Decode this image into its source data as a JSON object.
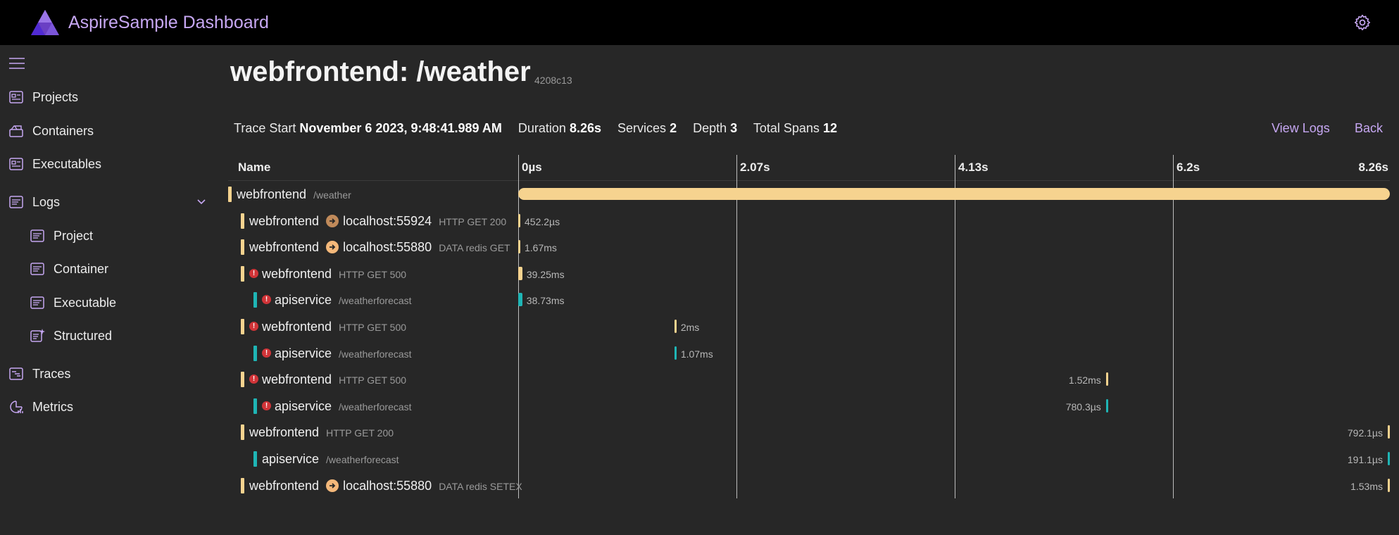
{
  "app": {
    "title": "AspireSample Dashboard"
  },
  "sidebar": {
    "items": [
      {
        "label": "Projects",
        "icon": "projects-icon"
      },
      {
        "label": "Containers",
        "icon": "containers-icon"
      },
      {
        "label": "Executables",
        "icon": "executables-icon"
      },
      {
        "label": "Logs",
        "icon": "logs-icon",
        "expanded": true
      },
      {
        "label": "Project",
        "icon": "log-file-icon"
      },
      {
        "label": "Container",
        "icon": "log-file-icon"
      },
      {
        "label": "Executable",
        "icon": "log-file-icon"
      },
      {
        "label": "Structured",
        "icon": "structured-log-icon"
      },
      {
        "label": "Traces",
        "icon": "traces-icon"
      },
      {
        "label": "Metrics",
        "icon": "metrics-icon"
      }
    ]
  },
  "trace": {
    "title": "webfrontend: /weather",
    "id": "4208c13",
    "start_label": "Trace Start",
    "start_value": "November 6 2023, 9:48:41.989 AM",
    "duration_label": "Duration",
    "duration_value": "8.26s",
    "services_label": "Services",
    "services_value": "2",
    "depth_label": "Depth",
    "depth_value": "3",
    "spans_label": "Total Spans",
    "spans_value": "12",
    "view_logs": "View Logs",
    "back": "Back"
  },
  "table": {
    "name_header": "Name",
    "ticks": [
      "0µs",
      "2.07s",
      "4.13s",
      "6.2s",
      "8.26s"
    ],
    "total_seconds": 8.26,
    "rows": [
      {
        "service": "webfrontend",
        "sub": "/weather",
        "peer": "",
        "color": "#f6d38f",
        "depth": 0,
        "error": false,
        "start": 0,
        "duration": 8.26,
        "dur_label": ""
      },
      {
        "service": "webfrontend",
        "sub": "HTTP GET 200",
        "peer": "localhost:55924",
        "peer_color": "#c08a5a",
        "color": "#f6d38f",
        "depth": 1,
        "error": false,
        "start": 0.0,
        "duration": 0.0004522,
        "dur_label": "452.2µs"
      },
      {
        "service": "webfrontend",
        "sub": "DATA redis GET",
        "peer": "localhost:55880",
        "peer_color": "#f4b87a",
        "color": "#f6d38f",
        "depth": 1,
        "error": false,
        "start": 0.0,
        "duration": 0.00167,
        "dur_label": "1.67ms"
      },
      {
        "service": "webfrontend",
        "sub": "HTTP GET 500",
        "peer": "",
        "color": "#f6d38f",
        "depth": 1,
        "error": true,
        "start": 0.0,
        "duration": 0.03925,
        "dur_label": "39.25ms"
      },
      {
        "service": "apiservice",
        "sub": "/weatherforecast",
        "peer": "",
        "color": "#1fb5b5",
        "depth": 2,
        "error": true,
        "start": 0.0,
        "duration": 0.03873,
        "dur_label": "38.73ms"
      },
      {
        "service": "webfrontend",
        "sub": "HTTP GET 500",
        "peer": "",
        "color": "#f6d38f",
        "depth": 1,
        "error": true,
        "start": 1.48,
        "duration": 0.002,
        "dur_label": "2ms"
      },
      {
        "service": "apiservice",
        "sub": "/weatherforecast",
        "peer": "",
        "color": "#1fb5b5",
        "depth": 2,
        "error": true,
        "start": 1.48,
        "duration": 0.00107,
        "dur_label": "1.07ms"
      },
      {
        "service": "webfrontend",
        "sub": "HTTP GET 500",
        "peer": "",
        "color": "#f6d38f",
        "depth": 1,
        "error": true,
        "start": 5.57,
        "duration": 0.00152,
        "dur_label": "1.52ms",
        "label_left": true
      },
      {
        "service": "apiservice",
        "sub": "/weatherforecast",
        "peer": "",
        "color": "#1fb5b5",
        "depth": 2,
        "error": true,
        "start": 5.57,
        "duration": 0.0007803,
        "dur_label": "780.3µs",
        "label_left": true
      },
      {
        "service": "webfrontend",
        "sub": "HTTP GET 200",
        "peer": "",
        "color": "#f6d38f",
        "depth": 1,
        "error": false,
        "start": 8.258,
        "duration": 0.0007921,
        "dur_label": "792.1µs",
        "label_left": true
      },
      {
        "service": "apiservice",
        "sub": "/weatherforecast",
        "peer": "",
        "color": "#1fb5b5",
        "depth": 2,
        "error": false,
        "start": 8.258,
        "duration": 0.0001911,
        "dur_label": "191.1µs",
        "label_left": true
      },
      {
        "service": "webfrontend",
        "sub": "DATA redis SETEX",
        "peer": "localhost:55880",
        "peer_color": "#f4b87a",
        "color": "#f6d38f",
        "depth": 1,
        "error": false,
        "start": 8.258,
        "duration": 0.00153,
        "dur_label": "1.53ms",
        "label_left": true
      }
    ]
  },
  "colors": {
    "accent": "#c6a7f2",
    "frontend": "#f6d38f",
    "api": "#1fb5b5",
    "error": "#d13438"
  }
}
